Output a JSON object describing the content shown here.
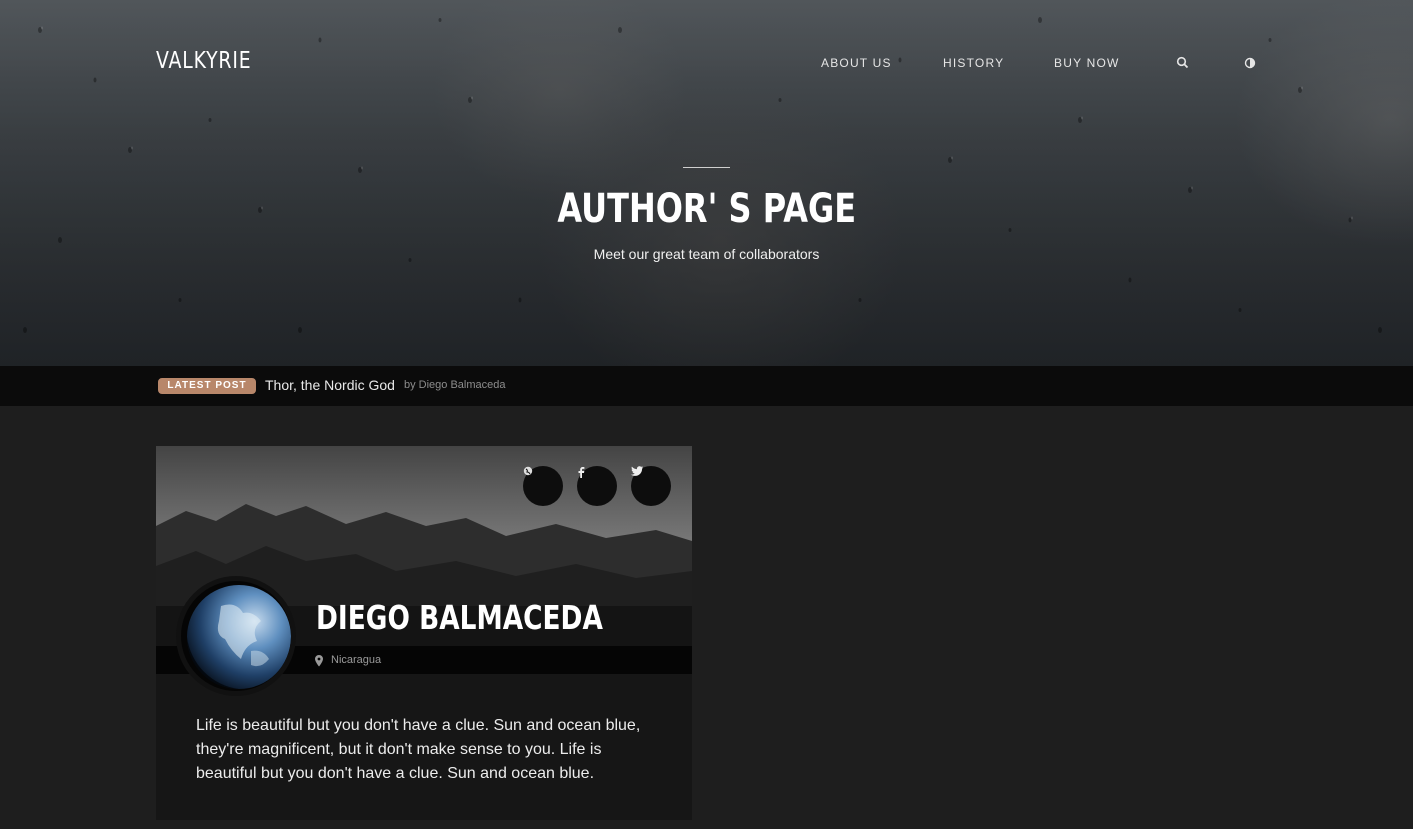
{
  "header": {
    "brand": "VALKYRIE",
    "nav": [
      "ABOUT US",
      "HISTORY",
      "BUY NOW"
    ],
    "icons": [
      "search-icon",
      "contrast-icon"
    ]
  },
  "hero": {
    "title": "AUTHOR' S PAGE",
    "subtitle": "Meet our great team of collaborators"
  },
  "ticker": {
    "badge": "LATEST POST",
    "title": "Thor, the Nordic God",
    "byline": "by Diego Balmaceda"
  },
  "author": {
    "name": "DIEGO BALMACEDA",
    "location": "Nicaragua",
    "bio": "Life is beautiful but you don't have a clue. Sun and ocean blue, they're magnificent, but it don't make sense to you. Life is beautiful but you don't have a clue. Sun and ocean blue.",
    "social": [
      "globe-icon",
      "facebook-icon",
      "twitter-icon"
    ]
  },
  "colors": {
    "badge": "#b8876a",
    "ticker_bg": "#0b0b0b",
    "page_bg": "#1e1e1e",
    "card_bg": "#161616"
  }
}
